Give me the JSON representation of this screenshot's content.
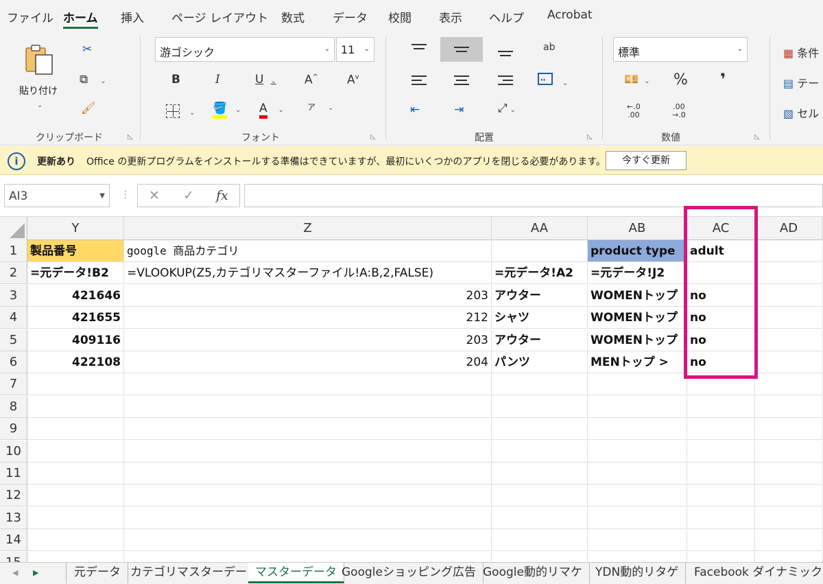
{
  "menu": {
    "tabs": [
      {
        "label": "ファイル",
        "active": false
      },
      {
        "label": "ホーム",
        "active": true
      },
      {
        "label": "挿入",
        "active": false
      },
      {
        "label": "ページ レイアウト",
        "active": false
      },
      {
        "label": "数式",
        "active": false
      },
      {
        "label": "データ",
        "active": false
      },
      {
        "label": "校閲",
        "active": false
      },
      {
        "label": "表示",
        "active": false
      },
      {
        "label": "ヘルプ",
        "active": false
      },
      {
        "label": "Acrobat",
        "active": false
      }
    ]
  },
  "ribbon": {
    "clipboard": {
      "paste_label": "貼り付け",
      "group_label": "クリップボード"
    },
    "font": {
      "font_name": "游ゴシック",
      "font_size": "11",
      "group_label": "フォント",
      "bold": "B",
      "italic": "I",
      "underline": "U",
      "grow": "A",
      "shrink": "A",
      "font_color_glyph": "A",
      "phonetic_glyph": "ア"
    },
    "alignment": {
      "group_label": "配置",
      "wrap_glyph": "ab"
    },
    "number": {
      "format": "標準",
      "group_label": "数値",
      "percent": "%",
      "comma": "❜",
      "inc_decimal": "←.0\n.00",
      "dec_decimal": ".00\n→.0"
    },
    "styles": {
      "conditional": "条件",
      "table": "テー",
      "cell": "セル"
    }
  },
  "notice": {
    "title": "更新あり",
    "message": "Office の更新プログラムをインストールする準備はできていますが、最初にいくつかのアプリを閉じる必要があります。",
    "button": "今すぐ更新"
  },
  "formula_bar": {
    "name_box": "AI3",
    "fx": "fx",
    "value": ""
  },
  "grid": {
    "columns": [
      "Y",
      "Z",
      "AA",
      "AB",
      "AC",
      "AD"
    ],
    "rows": [
      {
        "num": "1",
        "Y": "製品番号",
        "Z": "google 商品カテゴリ",
        "AA": "",
        "AB": "product type",
        "AC": "adult",
        "AD": ""
      },
      {
        "num": "2",
        "Y": "=元データ!B2",
        "Z": "=VLOOKUP(Z5,カテゴリマスターファイル!A:B,2,FALSE)",
        "AA": "=元データ!A2",
        "AB": "=元データ!J2",
        "AC": "",
        "AD": ""
      },
      {
        "num": "3",
        "Y": "421646",
        "Z": "203",
        "AA": "アウター",
        "AB": "WOMENトップ",
        "AC": "no",
        "AD": ""
      },
      {
        "num": "4",
        "Y": "421655",
        "Z": "212",
        "AA": "シャツ",
        "AB": "WOMENトップ",
        "AC": "no",
        "AD": ""
      },
      {
        "num": "5",
        "Y": "409116",
        "Z": "203",
        "AA": "アウター",
        "AB": "WOMENトップ",
        "AC": "no",
        "AD": ""
      },
      {
        "num": "6",
        "Y": "422108",
        "Z": "204",
        "AA": "パンツ",
        "AB": "MENトップ >",
        "AC": "no",
        "AD": ""
      },
      {
        "num": "7"
      },
      {
        "num": "8"
      },
      {
        "num": "9"
      },
      {
        "num": "10"
      },
      {
        "num": "11"
      },
      {
        "num": "12"
      },
      {
        "num": "13"
      },
      {
        "num": "14"
      },
      {
        "num": "15"
      }
    ]
  },
  "highlight": {
    "color": "#d6167e",
    "column": "AC"
  },
  "sheets": [
    {
      "label": "元データ",
      "active": false
    },
    {
      "label": "カテゴリマスターデータ",
      "active": false
    },
    {
      "label": "マスターデータ",
      "active": true
    },
    {
      "label": "Googleショッピング広告",
      "active": false
    },
    {
      "label": "Google動的リマケ",
      "active": false
    },
    {
      "label": "YDN動的リタゲ",
      "active": false
    },
    {
      "label": "Facebook ダイナミック広",
      "active": false
    }
  ],
  "colors": {
    "excel_green": "#1e7145",
    "header_yellow": "#ffd966",
    "header_blue": "#8ea9db",
    "notice_bg": "#fdf3c4"
  }
}
